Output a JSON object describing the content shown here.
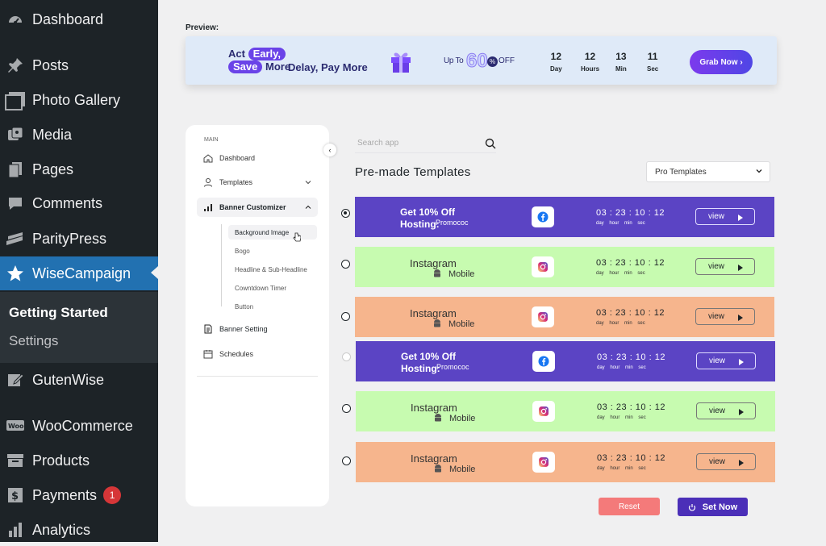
{
  "sidebar": {
    "items": [
      {
        "label": "Dashboard",
        "icon": "dashboard-icon"
      },
      {
        "label": "Posts",
        "icon": "pushpin-icon"
      },
      {
        "label": "Photo Gallery",
        "icon": "gallery-icon"
      },
      {
        "label": "Media",
        "icon": "media-icon"
      },
      {
        "label": "Pages",
        "icon": "pages-icon"
      },
      {
        "label": "Comments",
        "icon": "comments-icon"
      },
      {
        "label": "ParityPress",
        "icon": "paritypress-icon"
      },
      {
        "label": "WiseCampaign",
        "icon": "star-icon"
      },
      {
        "label": "GutenWise",
        "icon": "gutenwise-icon"
      },
      {
        "label": "WooCommerce",
        "icon": "woo-icon"
      },
      {
        "label": "Products",
        "icon": "archive-icon"
      },
      {
        "label": "Payments",
        "icon": "payments-icon",
        "badge": "1"
      },
      {
        "label": "Analytics",
        "icon": "analytics-icon"
      }
    ],
    "submenu": {
      "getting_started": "Getting Started",
      "settings": "Settings"
    }
  },
  "preview": {
    "label": "Preview:",
    "act": "Act",
    "early": "Early,",
    "save": "Save",
    "more": "More",
    "delay": "Delay, Pay More",
    "upto": "Up To",
    "sixty": "60",
    "percent": "%",
    "off": "OFF",
    "countdown": [
      {
        "value": "12",
        "label": "Day"
      },
      {
        "value": "12",
        "label": "Hours"
      },
      {
        "value": "13",
        "label": "Min"
      },
      {
        "value": "11",
        "label": "Sec"
      }
    ],
    "grab": "Grab Now ›"
  },
  "panel": {
    "main_label": "MAIN",
    "items": {
      "dashboard": "Dashboard",
      "templates": "Templates",
      "banner_customizer": "Banner Customizer",
      "banner_setting": "Banner Setting",
      "schedules": "Schedules"
    },
    "subitems": [
      "Background Image",
      "Bogo",
      "Headline & Sub-Headline",
      "Cowntdown Timer",
      "Button"
    ]
  },
  "search": {
    "placeholder": "Search app"
  },
  "heading": "Pre-made Templates",
  "select": {
    "value": "Pro Templates"
  },
  "templates": [
    {
      "style": "hosting",
      "line1": "Get 10% Off",
      "line2": "Hosting:",
      "promo": "Promococ",
      "countdown": "03 : 23 : 10 : 12",
      "units": "day hour min sec",
      "view": "view",
      "color": "#5b44c4",
      "selected": true
    },
    {
      "style": "instagram",
      "title": "Instagram",
      "sub": "Mobile",
      "countdown": "03 : 23 : 10 : 12",
      "units": "day hour min sec",
      "view": "view",
      "color": "#c7fbb0"
    },
    {
      "style": "instagram",
      "title": "Instagram",
      "sub": "Mobile",
      "countdown": "03 : 23 : 10 : 12",
      "units": "day hour min sec",
      "view": "view",
      "color": "#f6b58d"
    },
    {
      "style": "hosting",
      "line1": "Get 10% Off",
      "line2": "Hosting:",
      "promo": "Promococ",
      "countdown": "03 : 23 : 10 : 12",
      "units": "day hour min sec",
      "view": "view",
      "color": "#5b44c4"
    },
    {
      "style": "instagram",
      "title": "Instagram",
      "sub": "Mobile",
      "countdown": "03 : 23 : 10 : 12",
      "units": "day hour min sec",
      "view": "view",
      "color": "#c7fbb0"
    },
    {
      "style": "instagram",
      "title": "Instagram",
      "sub": "Mobile",
      "countdown": "03 : 23 : 10 : 12",
      "units": "day hour min sec",
      "view": "view",
      "color": "#f6b58d"
    }
  ],
  "actions": {
    "reset": "Reset",
    "set_now": "Set Now"
  }
}
